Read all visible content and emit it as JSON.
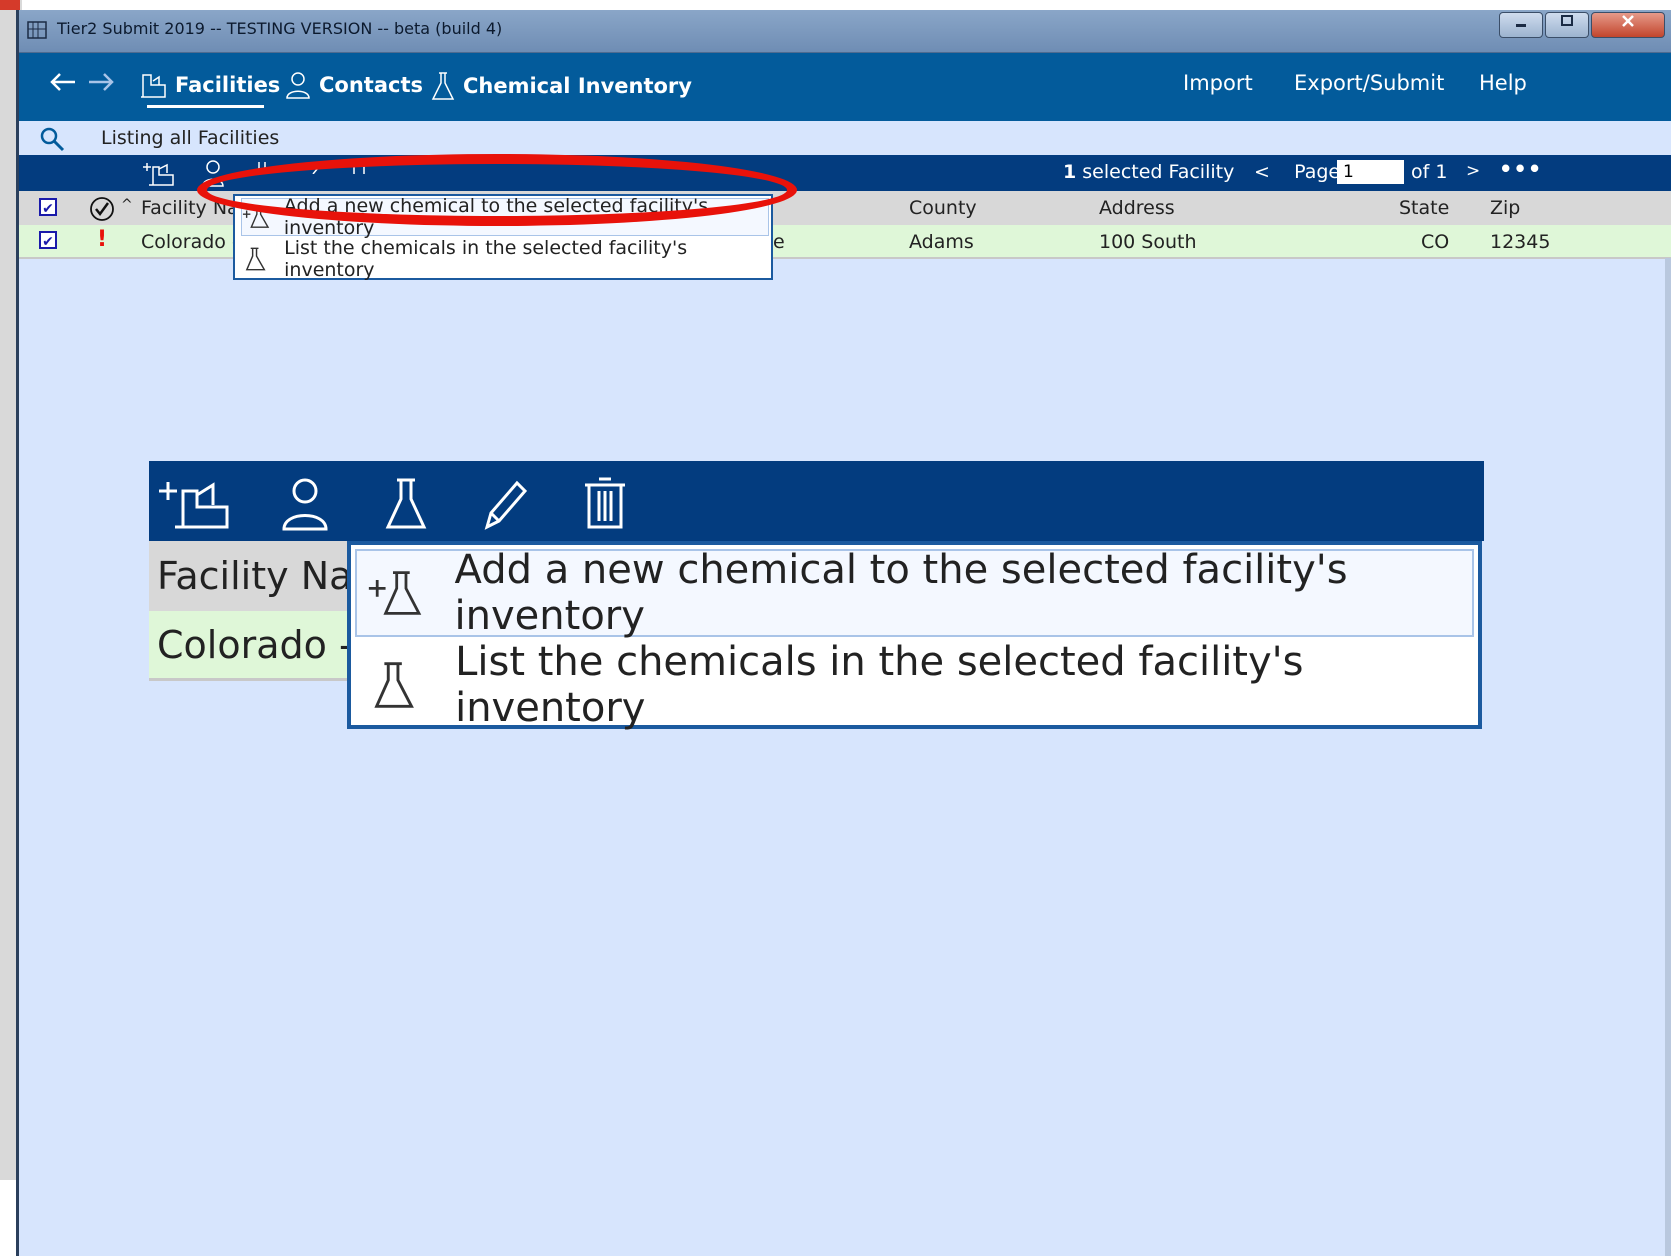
{
  "window": {
    "title": "Tier2 Submit 2019 -- TESTING VERSION -- beta (build 4)"
  },
  "nav": {
    "facilities": "Facilities",
    "contacts": "Contacts",
    "chemical_inventory": "Chemical Inventory",
    "import": "Import",
    "export_submit": "Export/Submit",
    "help": "Help"
  },
  "search": {
    "status": "Listing all Facilities"
  },
  "toolbar": {
    "selected_count": "1",
    "selected_label": "selected Facility",
    "prev": "<",
    "page_label": "Page",
    "page_value": "1",
    "of_label": "of 1",
    "next": ">",
    "more": "•••"
  },
  "table": {
    "headers": {
      "facility_name": "Facility Name",
      "county": "County",
      "address": "Address",
      "state": "State",
      "zip": "Zip"
    },
    "rows": [
      {
        "name": "Colorado -",
        "trail": "e",
        "county": "Adams",
        "address": "100 South",
        "state": "CO",
        "zip": "12345"
      }
    ]
  },
  "menu": {
    "add_chemical": "Add a new chemical to the selected facility's inventory",
    "list_chemicals": "List the chemicals in the selected facility's inventory"
  },
  "zoom": {
    "header_text": "Facility Na",
    "row_text": "Colorado -"
  },
  "colors": {
    "nav_bg": "#035b9b",
    "toolbar_bg": "#033c7f",
    "content_bg": "#d7e5fd",
    "row_bg": "#dff7d8",
    "highlight": "#e8120a"
  }
}
